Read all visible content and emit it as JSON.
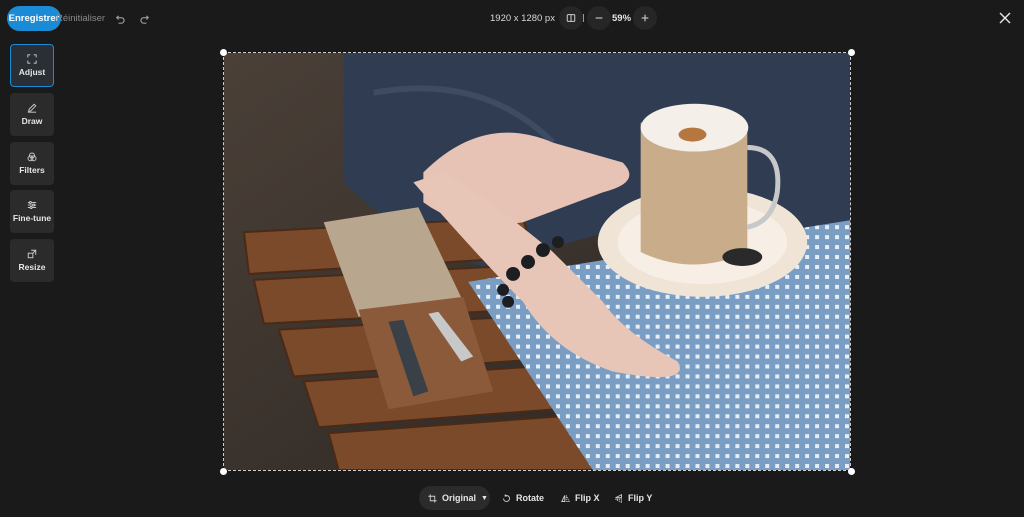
{
  "toolbar": {
    "save_label": "Enregistrer",
    "reset_label": "Réinitialiser",
    "dimensions": "1920 x 1280 px",
    "zoom": "59%"
  },
  "sidebar": {
    "items": [
      {
        "label": "Adjust",
        "icon": "crop-icon",
        "active": true
      },
      {
        "label": "Draw",
        "icon": "pencil-icon",
        "active": false
      },
      {
        "label": "Filters",
        "icon": "filters-icon",
        "active": false
      },
      {
        "label": "Fine-tune",
        "icon": "sliders-icon",
        "active": false
      },
      {
        "label": "Resize",
        "icon": "resize-icon",
        "active": false
      }
    ]
  },
  "bottom": {
    "ratio_label": "Original",
    "rotate_label": "Rotate",
    "flipx_label": "Flip X",
    "flipy_label": "Flip Y"
  },
  "colors": {
    "accent": "#1b8bd6",
    "background": "#1a1a1a",
    "panel": "#2b2b2b"
  }
}
